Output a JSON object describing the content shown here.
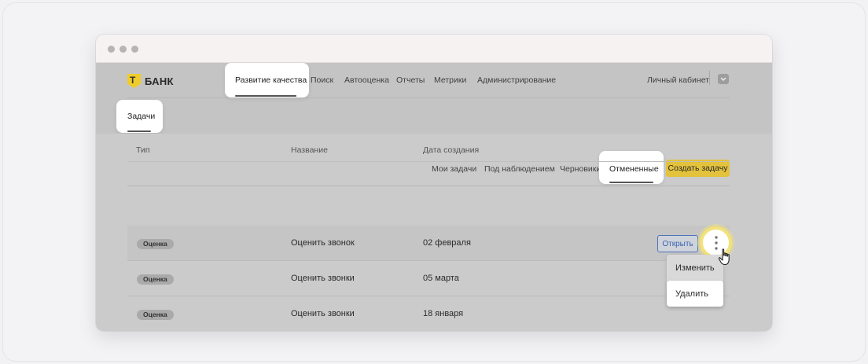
{
  "logo": {
    "text": "БАНК",
    "color": "#f0cc2a"
  },
  "nav": {
    "active": "Развитие качества",
    "items": [
      "Поиск",
      "Автооценка",
      "Отчеты",
      "Метрики",
      "Администрирование"
    ],
    "cabinet": "Личный кабинет"
  },
  "section_tab": "Задачи",
  "subtabs": {
    "items": [
      "Мои задачи",
      "Под наблюдением",
      "Черновики"
    ],
    "active": "Отмененные",
    "create_label": "Создать задачу"
  },
  "table": {
    "headers": [
      "Тип",
      "Название",
      "Дата создания"
    ],
    "rows": [
      {
        "type": "Оценка",
        "name": "Оценить звонок",
        "date": "02 февраля"
      },
      {
        "type": "Оценка",
        "name": "Оценить звонки",
        "date": "05 марта"
      },
      {
        "type": "Оценка",
        "name": "Оценить звонки",
        "date": "18 января"
      }
    ],
    "open_label": "Открыть"
  },
  "menu": {
    "items": [
      "Изменить",
      "Удалить"
    ]
  },
  "colors": {
    "accent": "#e3c23c",
    "link": "#3b63b0",
    "highlight_ring": "#f2e27a"
  }
}
